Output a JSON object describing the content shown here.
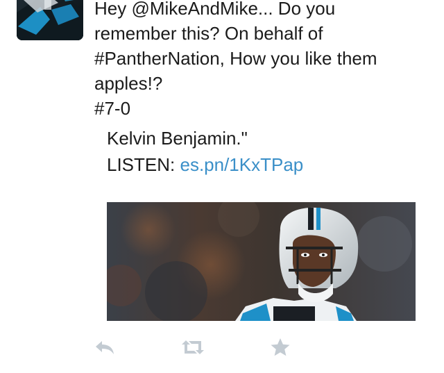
{
  "tweet": {
    "text": "Hey @MikeAndMike... Do you\nremember this? On behalf of\n#PantherNation, How you like them\napples!?\n#7-0"
  },
  "quoted": {
    "line1": "Kelvin Benjamin.\"",
    "listen_label": "LISTEN: ",
    "link": "es.pn/1KxTPap"
  },
  "icons": {
    "reply": "reply-icon",
    "retweet": "retweet-icon",
    "favorite": "star-icon"
  },
  "colors": {
    "link": "#3a8fc8",
    "text": "#1b1b1b",
    "action_icon": "#c3cbd2"
  }
}
